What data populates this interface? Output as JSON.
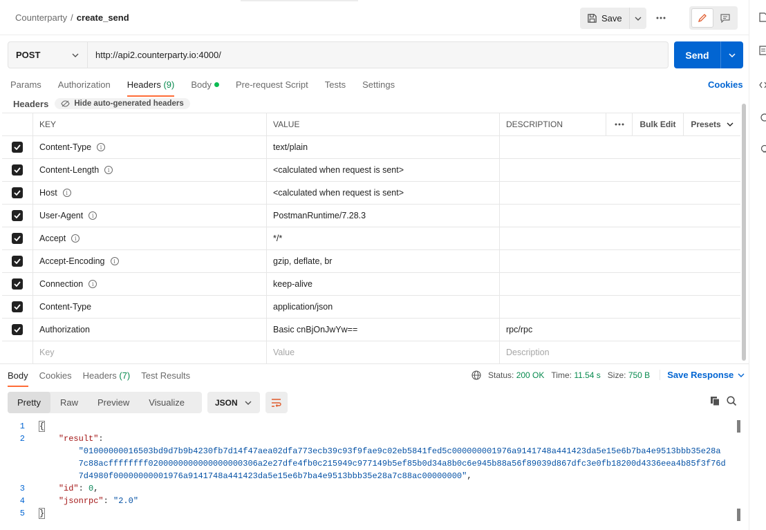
{
  "breadcrumb": {
    "parent": "Counterparty",
    "separator": "/",
    "current": "create_send"
  },
  "toolbar": {
    "save_label": "Save"
  },
  "request": {
    "method": "POST",
    "url": "http://api2.counterparty.io:4000/",
    "send_label": "Send"
  },
  "tabs": {
    "params": "Params",
    "authorization": "Authorization",
    "headers": "Headers",
    "headers_count": "(9)",
    "body": "Body",
    "prerequest": "Pre-request Script",
    "tests": "Tests",
    "settings": "Settings",
    "cookies": "Cookies"
  },
  "headers_section": {
    "title": "Headers",
    "hide_label": "Hide auto-generated headers",
    "columns": {
      "key": "KEY",
      "value": "VALUE",
      "description": "DESCRIPTION",
      "bulk_edit": "Bulk Edit",
      "presets": "Presets"
    },
    "rows": [
      {
        "key": "Content-Type",
        "info": true,
        "value": "text/plain",
        "description": ""
      },
      {
        "key": "Content-Length",
        "info": true,
        "value": "<calculated when request is sent>",
        "description": ""
      },
      {
        "key": "Host",
        "info": true,
        "value": "<calculated when request is sent>",
        "description": ""
      },
      {
        "key": "User-Agent",
        "info": true,
        "value": "PostmanRuntime/7.28.3",
        "description": ""
      },
      {
        "key": "Accept",
        "info": true,
        "value": "*/*",
        "description": ""
      },
      {
        "key": "Accept-Encoding",
        "info": true,
        "value": "gzip, deflate, br",
        "description": ""
      },
      {
        "key": "Connection",
        "info": true,
        "value": "keep-alive",
        "description": ""
      },
      {
        "key": "Content-Type",
        "info": false,
        "value": "application/json",
        "description": ""
      },
      {
        "key": "Authorization",
        "info": false,
        "value": "Basic cnBjOnJwYw==",
        "description": "rpc/rpc"
      }
    ],
    "placeholders": {
      "key": "Key",
      "value": "Value",
      "description": "Description"
    }
  },
  "response": {
    "tabs": {
      "body": "Body",
      "cookies": "Cookies",
      "headers": "Headers",
      "headers_count": "(7)",
      "test_results": "Test Results"
    },
    "status_label": "Status:",
    "status_value": "200 OK",
    "time_label": "Time:",
    "time_value": "11.54 s",
    "size_label": "Size:",
    "size_value": "750 B",
    "save_response": "Save Response",
    "views": {
      "pretty": "Pretty",
      "raw": "Raw",
      "preview": "Preview",
      "visualize": "Visualize"
    },
    "format": "JSON",
    "code": {
      "line_numbers": [
        "1",
        "2",
        "3",
        "4",
        "5"
      ],
      "open_brace": "{",
      "close_brace": "}",
      "result_key": "\"result\"",
      "result_value_1": "\"01000000016503bd9d7b9b4230fb7d14f47aea02dfa773ecb39c93f9fae9c02eb5841fed5c000000001976a9141748a441423da5e15e6b7ba4e9513bbb35e28a",
      "result_value_2": "7c88acffffffff0200000000000000000306a2e27dfe4fb0c215949c977149b5ef85b0d34a8b0c6e945b88a56f89039d867dfc3e0fb18200d4336eea4b85f3f76d",
      "result_value_3": "7d4980f00000000001976a9141748a441423da5e15e6b7ba4e9513bbb35e28a7c88ac00000000\"",
      "id_key": "\"id\"",
      "id_value": "0",
      "jsonrpc_key": "\"jsonrpc\"",
      "jsonrpc_value": "\"2.0\""
    }
  },
  "colors": {
    "accent": "#ff6c37",
    "primary": "#0265d2",
    "success": "#078a4e"
  }
}
